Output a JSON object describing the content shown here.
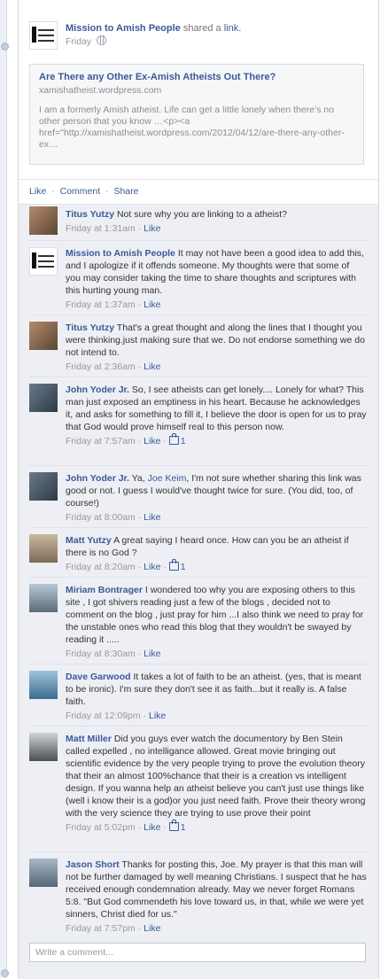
{
  "post": {
    "page_name": "Mission to Amish People",
    "shared_text": "shared a",
    "shared_link": "link.",
    "time": "Friday",
    "logo_text": [
      "MISSION",
      "AMISH",
      "PEOPLE"
    ]
  },
  "share": {
    "title": "Are There any Other Ex-Amish Atheists Out There?",
    "domain": "xamishatheist.wordpress.com",
    "desc": "I am a formerly Amish atheist. Life can get a little lonely when there’s no other person that you know …<p><a href=\"http://xamishatheist.wordpress.com/2012/04/12/are-there-any-other-ex…"
  },
  "actions": {
    "like": "Like",
    "comment": "Comment",
    "share": "Share",
    "sep": "·"
  },
  "comments": [
    {
      "name": "Titus Yutzy",
      "text": "Not sure why you are linking to a atheist?",
      "time": "Friday at 1:31am",
      "likes": ""
    },
    {
      "name": "Mission to Amish People",
      "text": "It may not have been a good idea to add this, and I apologize if it offends someone. My thoughts were that some of you may consider taking the time to share thoughts and scriptures with this hurting young man.",
      "time": "Friday at 1:37am",
      "likes": ""
    },
    {
      "name": "Titus Yutzy",
      "text": "That's a great thought and along the lines that I thought you were thinking.just making sure that we. Do not endorse something we do not intend to.",
      "time": "Friday at 2:36am",
      "likes": ""
    },
    {
      "name": "John Yoder Jr.",
      "text": "So, I see atheists can get lonely.... Lonely for what? This man just exposed an emptiness in his heart. Because he acknowledges it, and asks for something to fill it, I believe the door is open for us to pray that God would prove himself real to this person now.",
      "time": "Friday at 7:57am",
      "likes": "1"
    },
    {
      "name": "John Yoder Jr.",
      "mention": "Joe Keim",
      "text_before": "Ya,",
      "text": ", I'm not sure whether sharing this link was good or not. I guess I would've thought twice for sure. (You did, too, of course!)",
      "time": "Friday at 8:00am",
      "likes": ""
    },
    {
      "name": "Matt Yutzy",
      "text": "A great saying I heard once. How can you be an atheist if there is no God ?",
      "time": "Friday at 8:20am",
      "likes": "1"
    },
    {
      "name": "Miriam Bontrager",
      "text": "I wondered too why you are exposing others to this site , I got shivers reading just a few of the blogs , decided not to comment on the blog , just pray for him ...I also think we need to pray for the unstable ones who read this blog that they wouldn't be swayed by reading it .....",
      "time": "Friday at 8:30am",
      "likes": ""
    },
    {
      "name": "Dave Garwood",
      "text": "It takes a lot of faith to be an atheist. (yes, that is meant to be ironic). I'm sure they don't see it as faith...but it really is. A false faith.",
      "time": "Friday at 12:09pm",
      "likes": ""
    },
    {
      "name": "Matt Miller",
      "text": "Did you guys ever watch the documentory by Ben Stein called expelled , no intelligance allowed. Great movie bringing out scientific evidence by the very people trying to prove the evolution theory that their an almost 100%chance that their is a creation vs intelligent design. If you wanna help an atheist believe you can't just use things like (well i know their is a god)or you just need faith. Prove their theory wrong with the very science they are trying to use prove their point",
      "time": "Friday at 5:02pm",
      "likes": "1"
    },
    {
      "name": "Jason Short",
      "text": "Thanks for posting this, Joe. My prayer is that this man will not be further damaged by well meaning Christians. I suspect that he has received enough condemnation already. May we never forget Romans 5:8. \"But God commendeth his love toward us, in that, while we were yet sinners, Christ died for us.\"",
      "time": "Friday at 7:57pm",
      "likes": ""
    }
  ],
  "comment_like_label": "Like",
  "meta_sep": "·",
  "write_placeholder": "Write a comment..."
}
